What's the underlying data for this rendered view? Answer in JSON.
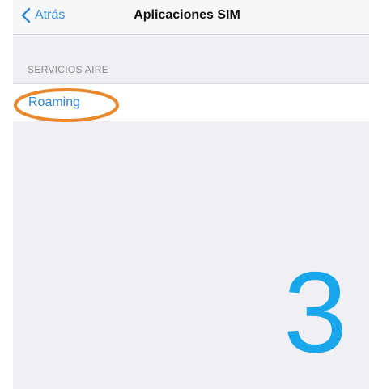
{
  "navbar": {
    "back_label": "Atrás",
    "title": "Aplicaciones SIM"
  },
  "section": {
    "header": "SERVICIOS AIRE",
    "items": [
      {
        "label": "Roaming"
      }
    ]
  },
  "annotation": {
    "step_number": "3",
    "highlight_color": "#e9892d",
    "number_color": "#17a7ea"
  },
  "colors": {
    "accent": "#2f86d6",
    "background": "#efeff4"
  },
  "icons": {
    "back": "chevron-left-icon"
  }
}
